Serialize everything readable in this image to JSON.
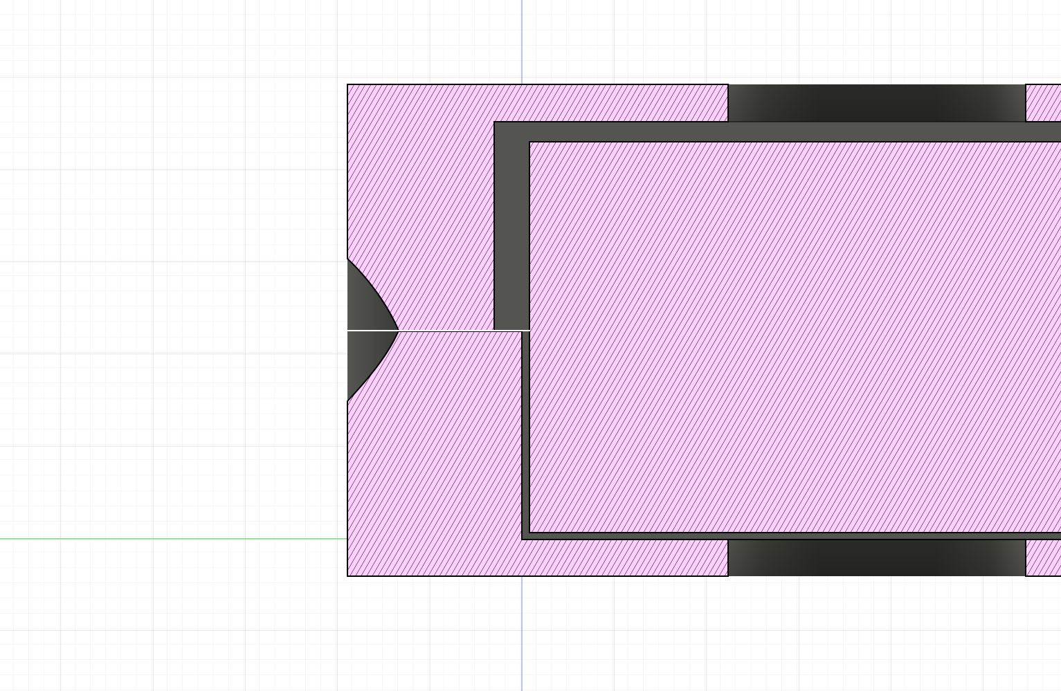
{
  "viewport": {
    "label": "",
    "background": "#ffffff"
  },
  "colors": {
    "grid_minor": "#eaeaea",
    "grid_major": "#c9c9c9",
    "axis_x": "#46d246",
    "axis_y": "#7d8ce0",
    "section_fill": "#ffd0ff",
    "hatch": "#000000",
    "outline": "#000000",
    "cavity_dark": "#4d4e4a",
    "cavity_shadow": "#2f302c",
    "seam": "#ffffff"
  },
  "view": {
    "mode": "section-analysis",
    "grid": true,
    "hatch_pattern": "diagonal-lines"
  }
}
